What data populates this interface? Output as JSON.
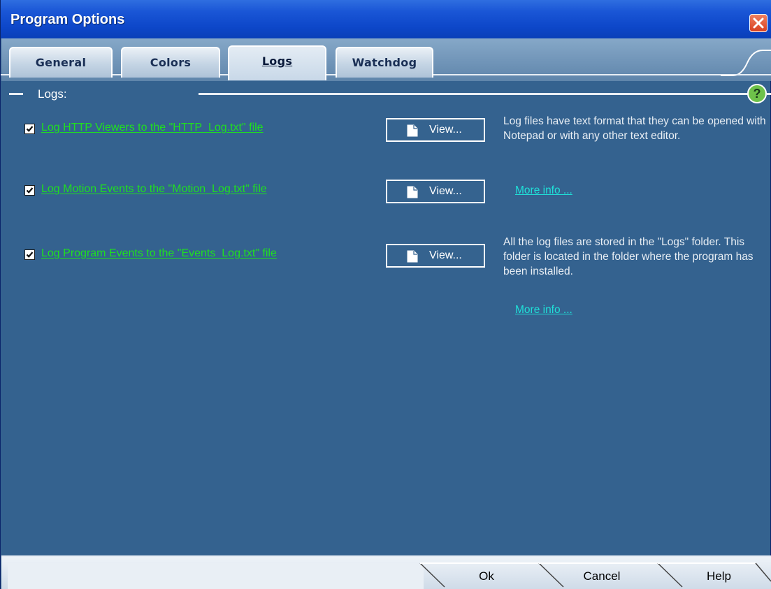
{
  "window": {
    "title": "Program Options"
  },
  "tabs": [
    {
      "label": "General",
      "active": false
    },
    {
      "label": "Colors",
      "active": false
    },
    {
      "label": "Logs",
      "active": true
    },
    {
      "label": "Watchdog",
      "active": false
    }
  ],
  "section": {
    "title": "Logs:",
    "help_icon": "?"
  },
  "options": [
    {
      "label": "Log HTTP Viewers to the \"HTTP_Log.txt\" file",
      "checked": true,
      "button_label": "View..."
    },
    {
      "label": "Log Motion Events to the \"Motion_Log.txt\" file",
      "checked": true,
      "button_label": "View..."
    },
    {
      "label": "Log Program Events to the \"Events_Log.txt\" file",
      "checked": true,
      "button_label": "View..."
    }
  ],
  "info": {
    "text1": "Log files have text format that they can be opened with Notepad or with any other text editor.",
    "link1": "More info ...",
    "text2": "All the log files are stored in the \"Logs\" folder. This folder is located in the folder where the program has been installed.",
    "link2": "More info ..."
  },
  "footer": {
    "ok": "Ok",
    "cancel": "Cancel",
    "help": "Help"
  },
  "colors": {
    "background": "#34628f",
    "option_text": "#1fe01f",
    "link_text": "#1fe0d8",
    "title_bar": "#0d47c9"
  },
  "icons": [
    "close-icon",
    "help-icon",
    "checkbox-checked-icon",
    "document-icon"
  ]
}
